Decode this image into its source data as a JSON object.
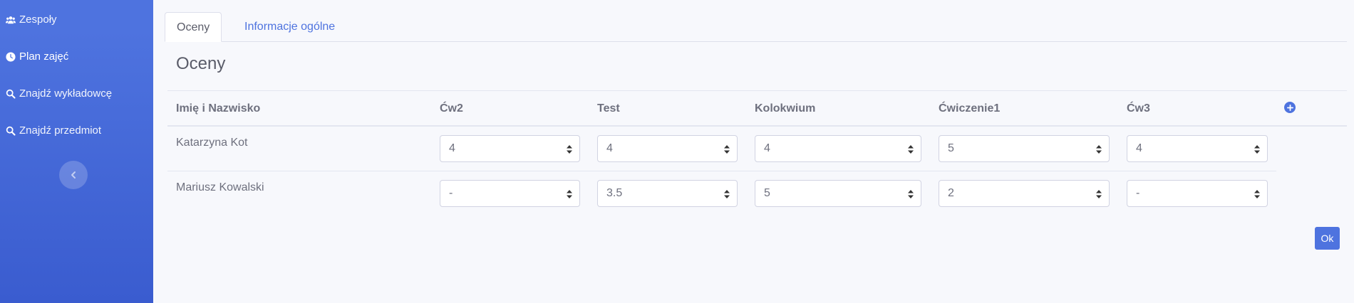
{
  "sidebar": {
    "items": [
      {
        "label": "Zespoły",
        "icon": "users-icon"
      },
      {
        "label": "Plan zajęć",
        "icon": "clock-icon"
      },
      {
        "label": "Znajdź wykładowcę",
        "icon": "search-icon"
      },
      {
        "label": "Znajdź przedmiot",
        "icon": "search-icon"
      }
    ],
    "toggle_icon": "chevron-left-icon"
  },
  "tabs": [
    {
      "label": "Oceny",
      "active": true
    },
    {
      "label": "Informacje ogólne",
      "active": false
    }
  ],
  "section_title": "Oceny",
  "table": {
    "columns": [
      "Imię i Nazwisko",
      "Ćw2",
      "Test",
      "Kolokwium",
      "Ćwiczenie1",
      "Ćw3"
    ],
    "add_column_icon": "plus-circle-icon",
    "rows": [
      {
        "name": "Katarzyna Kot",
        "grades": [
          "4",
          "4",
          "4",
          "5",
          "4"
        ]
      },
      {
        "name": "Mariusz Kowalski",
        "grades": [
          "-",
          "3.5",
          "5",
          "2",
          "-"
        ]
      }
    ]
  },
  "ok_label": "Ok",
  "colors": {
    "accent": "#4e73df",
    "sidebar_top": "#4e73df",
    "background": "#f7f8fc"
  }
}
